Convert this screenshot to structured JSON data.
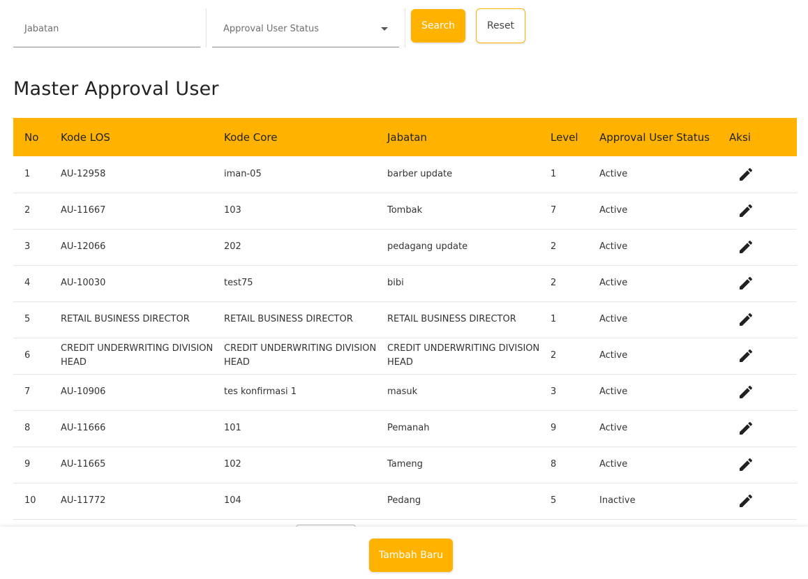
{
  "filters": {
    "jabatan_placeholder": "Jabatan",
    "status_placeholder": "Approval User Status",
    "search_label": "Search",
    "reset_label": "Reset"
  },
  "title": "Master Approval User",
  "table": {
    "headers": [
      "No",
      "Kode LOS",
      "Kode Core",
      "Jabatan",
      "Level",
      "Approval User Status",
      "Aksi"
    ],
    "rows": [
      {
        "no": "1",
        "kode_los": "AU-12958",
        "kode_core": "iman-05",
        "jabatan": "barber update",
        "level": "1",
        "status": "Active"
      },
      {
        "no": "2",
        "kode_los": "AU-11667",
        "kode_core": "103",
        "jabatan": "Tombak",
        "level": "7",
        "status": "Active"
      },
      {
        "no": "3",
        "kode_los": "AU-12066",
        "kode_core": "202",
        "jabatan": "pedagang update",
        "level": "2",
        "status": "Active"
      },
      {
        "no": "4",
        "kode_los": "AU-10030",
        "kode_core": "test75",
        "jabatan": "bibi",
        "level": "2",
        "status": "Active"
      },
      {
        "no": "5",
        "kode_los": "RETAIL BUSINESS DIRECTOR",
        "kode_core": "RETAIL BUSINESS DIRECTOR",
        "jabatan": "RETAIL BUSINESS DIRECTOR",
        "level": "1",
        "status": "Active"
      },
      {
        "no": "6",
        "kode_los": "CREDIT UNDERWRITING DIVISION HEAD",
        "kode_core": "CREDIT UNDERWRITING DIVISION HEAD",
        "jabatan": "CREDIT UNDERWRITING DIVISION HEAD",
        "level": "2",
        "status": "Active"
      },
      {
        "no": "7",
        "kode_los": "AU-10906",
        "kode_core": "tes konfirmasi 1",
        "jabatan": "masuk",
        "level": "3",
        "status": "Active"
      },
      {
        "no": "8",
        "kode_los": "AU-11666",
        "kode_core": "101",
        "jabatan": "Pemanah",
        "level": "9",
        "status": "Active"
      },
      {
        "no": "9",
        "kode_los": "AU-11665",
        "kode_core": "102",
        "jabatan": "Tameng",
        "level": "8",
        "status": "Active"
      },
      {
        "no": "10",
        "kode_los": "AU-11772",
        "kode_core": "104",
        "jabatan": "Pedang",
        "level": "5",
        "status": "Inactive"
      }
    ]
  },
  "footer": {
    "add_label": "Tambah Baru"
  },
  "icons": {
    "row_action": "edit-pencil-icon",
    "status_dropdown": "caret-down-icon"
  },
  "colors": {
    "accent": "#ffb300",
    "header_text": "#222222",
    "button_text": "#ffffff"
  }
}
